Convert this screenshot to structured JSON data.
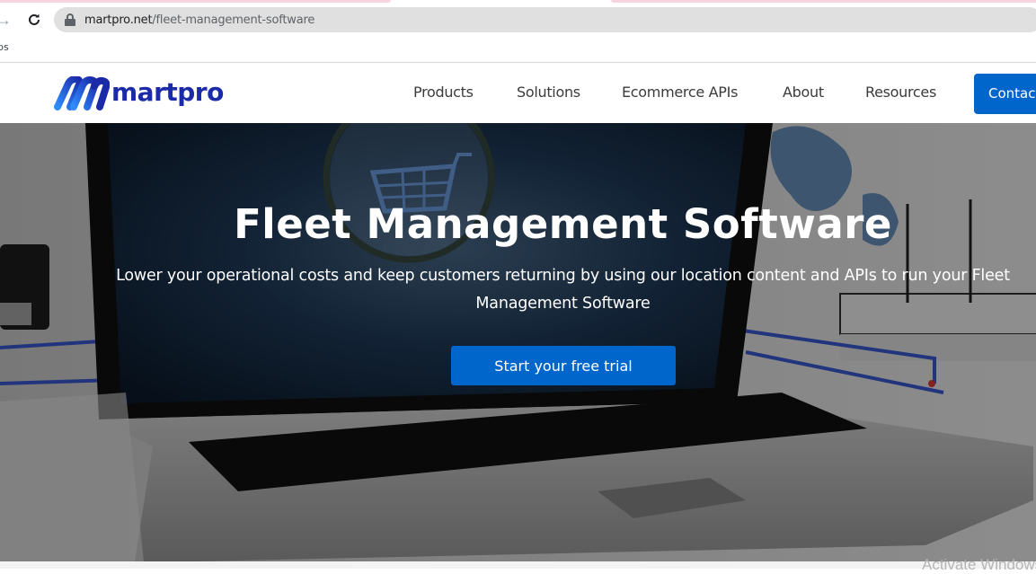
{
  "browser": {
    "url_domain": "martpro.net",
    "url_path": "/fleet-management-software",
    "bookmarks": [
      {
        "label": "ps"
      }
    ]
  },
  "header": {
    "logo_text": "martpro",
    "nav": [
      {
        "label": "Products"
      },
      {
        "label": "Solutions"
      },
      {
        "label": "Ecommerce APIs"
      },
      {
        "label": "About"
      },
      {
        "label": "Resources"
      }
    ],
    "contact_label": "Contact"
  },
  "hero": {
    "title": "Fleet Management Software",
    "subtitle": "Lower your operational costs and keep customers returning by using our location content and APIs to run your Fleet Management Software",
    "cta_label": "Start your free trial"
  },
  "system": {
    "watermark": "Activate Windows"
  },
  "colors": {
    "brand_blue": "#0066cc",
    "logo_blue": "#1b2aa8"
  }
}
